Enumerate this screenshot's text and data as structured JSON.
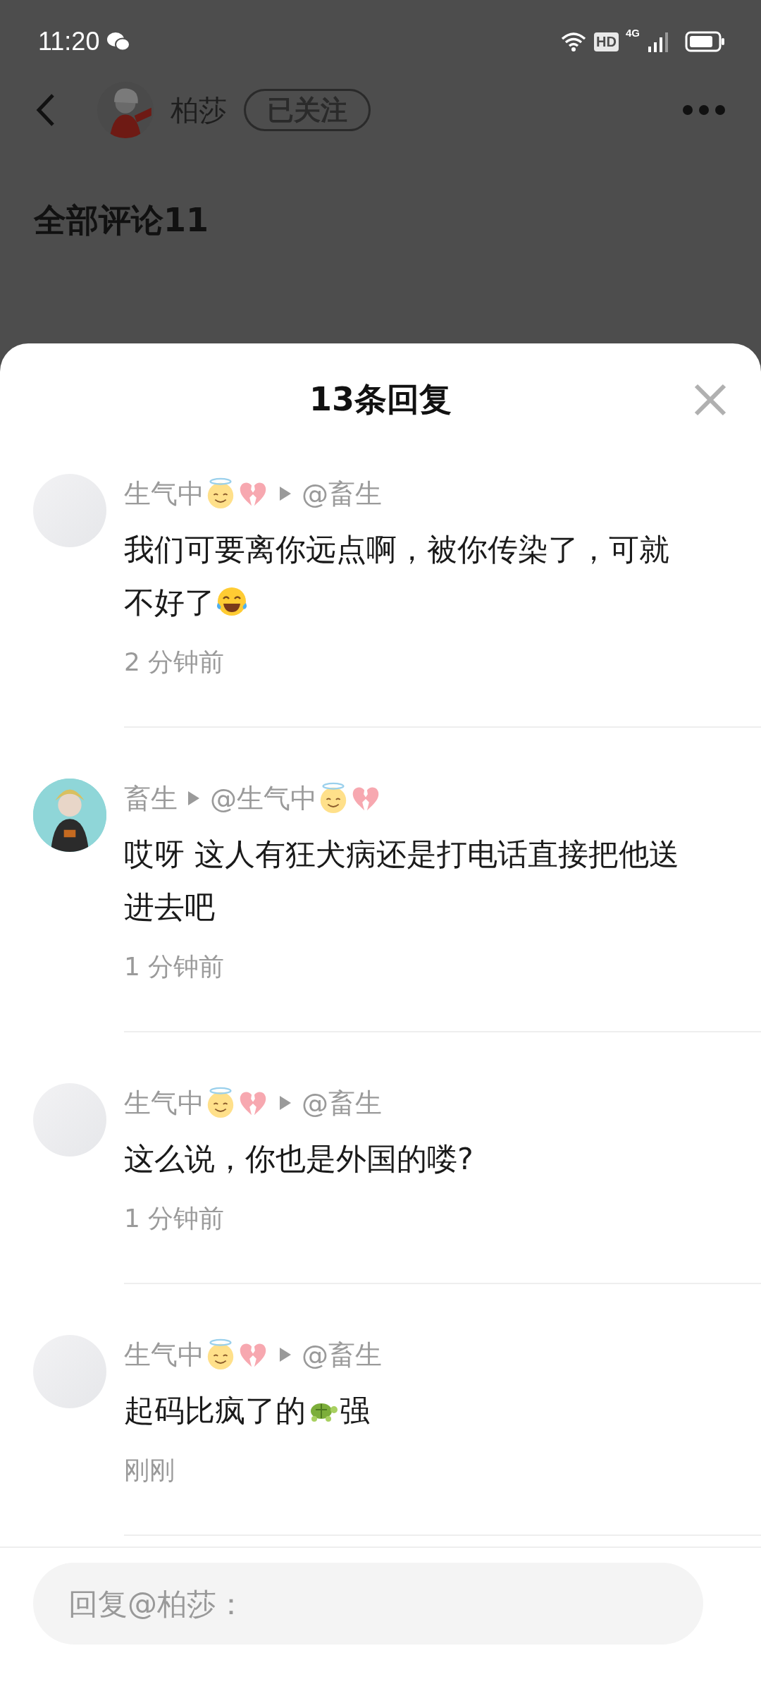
{
  "status_bar": {
    "time": "11:20",
    "hd": "HD",
    "network": "4G"
  },
  "header": {
    "user": {
      "name": "柏莎",
      "avatar": {
        "kind": "picture"
      }
    },
    "follow_button": {
      "label": "已关注"
    }
  },
  "comments_title": "全部评论11",
  "sheet": {
    "title": "13条回复",
    "replies": [
      {
        "author": {
          "name": "生气中",
          "icons": [
            {
              "kind": "angel"
            },
            {
              "kind": "broken_heart"
            }
          ]
        },
        "target": {
          "name": "@畜生"
        },
        "avatar": {
          "kind": "blank"
        },
        "content": [
          {
            "kind": "text",
            "text": "我们可要离你远点啊，被你传染了，可就不好了"
          },
          {
            "kind": "tears_of_joy"
          }
        ],
        "time": "2 分钟前"
      },
      {
        "author": {
          "name": "畜生"
        },
        "target": {
          "name": "@生气中",
          "icons": [
            {
              "kind": "angel"
            },
            {
              "kind": "broken_heart"
            }
          ]
        },
        "avatar": {
          "kind": "picture"
        },
        "content": [
          {
            "kind": "text",
            "text": "哎呀 这人有狂犬病还是打电话直接把他送进去吧"
          }
        ],
        "time": "1 分钟前"
      },
      {
        "author": {
          "name": "生气中",
          "icons": [
            {
              "kind": "angel"
            },
            {
              "kind": "broken_heart"
            }
          ]
        },
        "target": {
          "name": "@畜生"
        },
        "avatar": {
          "kind": "blank"
        },
        "content": [
          {
            "kind": "text",
            "text": "这么说，你也是外国的喽?"
          }
        ],
        "time": "1 分钟前"
      },
      {
        "author": {
          "name": "生气中",
          "icons": [
            {
              "kind": "angel"
            },
            {
              "kind": "broken_heart"
            }
          ]
        },
        "target": {
          "name": "@畜生"
        },
        "avatar": {
          "kind": "blank"
        },
        "content": [
          {
            "kind": "text",
            "text": "起码比疯了的"
          },
          {
            "kind": "turtle"
          },
          {
            "kind": "text",
            "text": "强"
          }
        ],
        "time": "刚刚"
      }
    ],
    "reply_field": {
      "placeholder": "回复@柏莎："
    }
  }
}
